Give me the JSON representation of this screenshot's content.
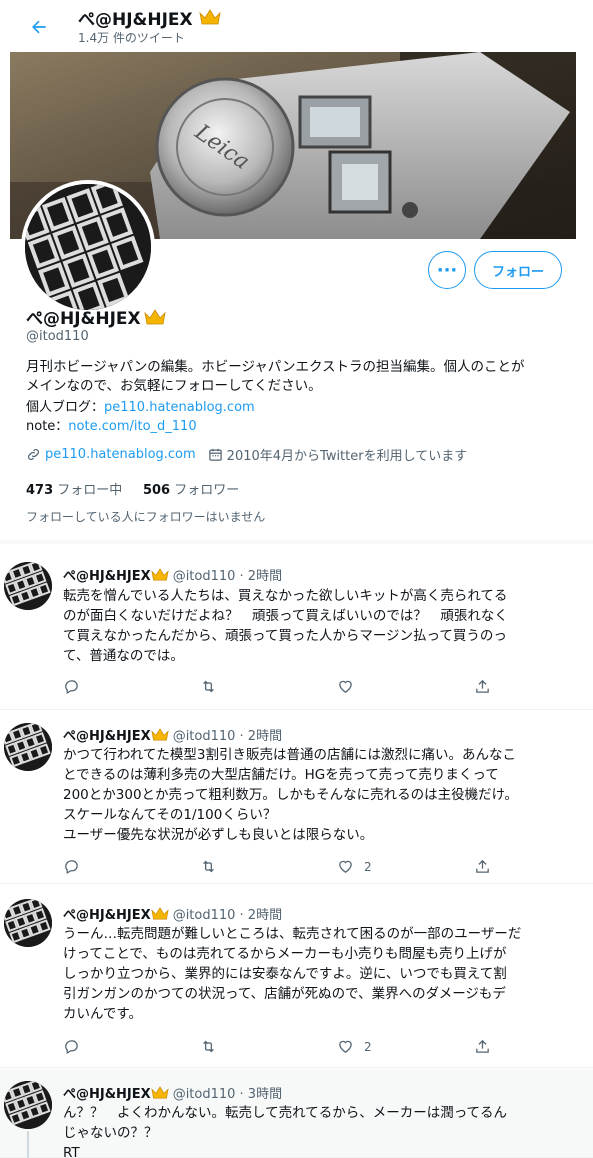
{
  "header": {
    "title": "ぺ@HJ&HJEX",
    "tweet_count": "1.4万 件のツイート"
  },
  "profile": {
    "name": "ぺ@HJ&HJEX",
    "handle": "@itod110",
    "bio": "月刊ホビージャパンの編集。ホビージャパンエクストラの担当編集。個人のことが\nメインなので、お気軽にフォローしてください。",
    "blog_label": "個人ブログ：",
    "blog_link": "pe110.hatenablog.com",
    "note_label": "note：",
    "note_link": "note.com/ito_d_110",
    "website": "pe110.hatenablog.com",
    "joined": "2010年4月からTwitterを利用しています",
    "following_count": "473",
    "following_label": "フォロー中",
    "followers_count": "506",
    "followers_label": "フォロワー",
    "followed_by_note": "フォローしている人にフォロワーはいません",
    "more_button": "···",
    "follow_button": "フォロー"
  },
  "tweets": [
    {
      "name": "ぺ@HJ&HJEX",
      "handle_time": "@itod110 · 2時間",
      "text": "転売を憎んでいる人たちは、買えなかった欲しいキットが高く売られてる\nのが面白くないだけだよね？　頑張って買えばいいのでは？　頑張れなく\nて買えなかったんだから、頑張って買った人からマージン払って買うのっ\nて、普通なのでは。",
      "likes": ""
    },
    {
      "name": "ぺ@HJ&HJEX",
      "handle_time": "@itod110 · 2時間",
      "text": "かつて行われてた模型3割引き販売は普通の店舗には激烈に痛い。あんなこ\nとできるのは薄利多売の大型店舗だけ。HGを売って売って売りまくって\n200とか300とか売って粗利数万。しかもそんなに売れるのは主役機だけ。\nスケールなんてその1/100くらい？\nユーザー優先な状況が必ずしも良いとは限らない。",
      "likes": "2"
    },
    {
      "name": "ぺ@HJ&HJEX",
      "handle_time": "@itod110 · 2時間",
      "text": "うーん…転売問題が難しいところは、転売されて困るのが一部のユーザーだ\nけってことで、ものは売れてるからメーカーも小売りも問屋も売り上げが\nしっかり立つから、業界的には安泰なんですよ。逆に、いつでも買えて割\n引ガンガンのかつての状況って、店舗が死ぬので、業界へのダメージもデ\nカいんです。",
      "likes": "2"
    },
    {
      "name": "ぺ@HJ&HJEX",
      "handle_time": "@itod110 · 3時間",
      "text": "ん？？　よくわかんない。転売して売れてるから、メーカーは潤ってるん\nじゃないの？？\nRT",
      "likes": ""
    }
  ],
  "colors": {
    "accent": "#1d9bf0",
    "muted": "#536471",
    "crown": "#f4b400"
  }
}
